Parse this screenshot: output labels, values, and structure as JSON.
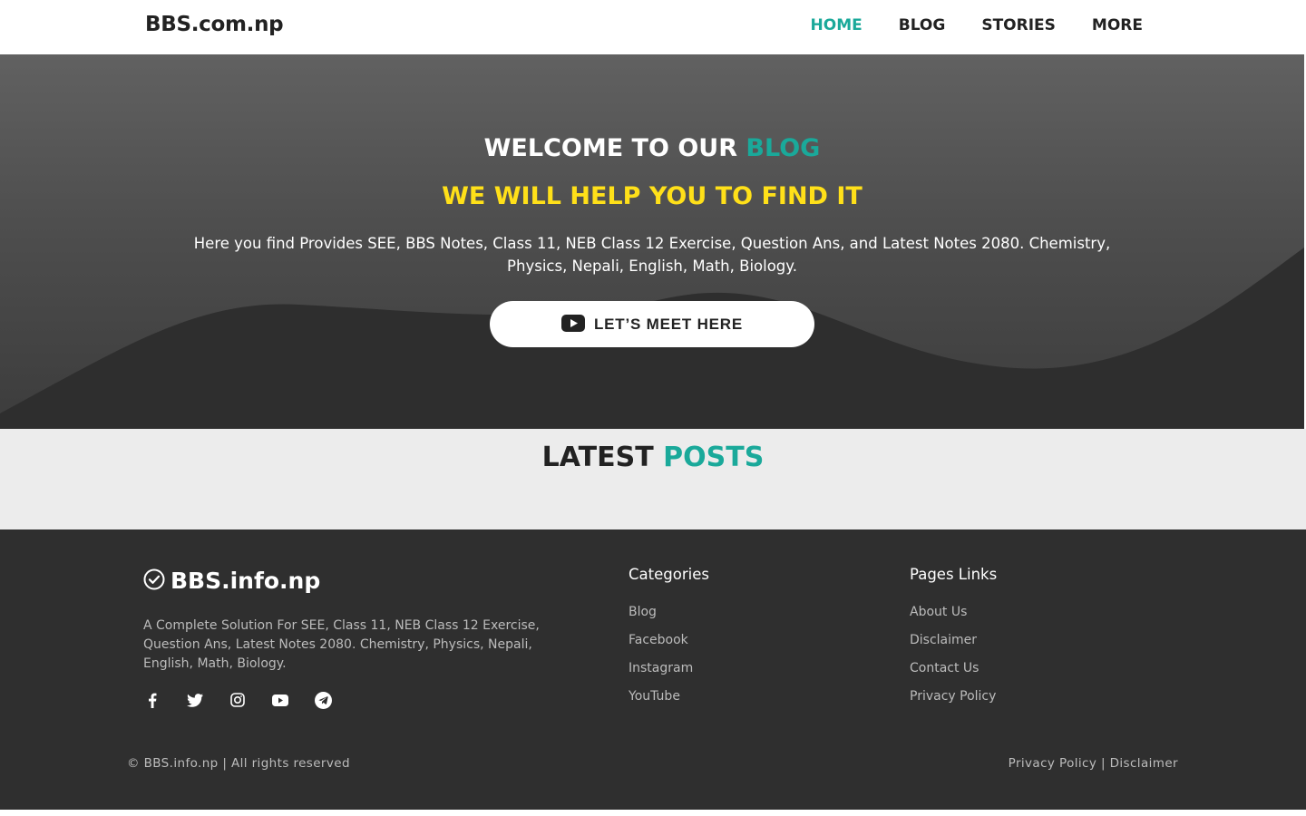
{
  "header": {
    "logo": "BBS.com.np",
    "nav": [
      {
        "label": "HOME",
        "active": true
      },
      {
        "label": "BLOG",
        "active": false
      },
      {
        "label": "STORIES",
        "active": false
      },
      {
        "label": "MORE",
        "active": false
      }
    ]
  },
  "hero": {
    "title_prefix": "WELCOME TO OUR",
    "title_accent": "BLOG",
    "subtitle": "WE WILL HELP YOU TO FIND IT",
    "description": "Here you find Provides SEE, BBS Notes, Class 11, NEB Class 12 Exercise, Question Ans, and Latest Notes 2080. Chemistry, Physics, Nepali, English, Math, Biology.",
    "button_label": "LET’S MEET HERE",
    "button_icon": "youtube-icon"
  },
  "latest": {
    "title_prefix": "LATEST",
    "title_accent": "POSTS"
  },
  "footer": {
    "brand": "BBS.info.np",
    "brand_icon": "check-circle-icon",
    "about": "A Complete Solution For SEE, Class 11, NEB Class 12 Exercise, Question Ans, Latest Notes 2080. Chemistry, Physics, Nepali, English, Math, Biology.",
    "social_icons": [
      "facebook-icon",
      "twitter-icon",
      "instagram-icon",
      "youtube-icon",
      "telegram-icon"
    ],
    "categories": {
      "heading": "Categories",
      "links": [
        "Blog",
        "Facebook",
        "Instagram",
        "YouTube"
      ]
    },
    "pages": {
      "heading": "Pages Links",
      "links": [
        "About Us",
        "Disclaimer",
        "Contact Us",
        "Privacy Policy"
      ]
    },
    "copyright": "© BBS.info.np | All rights reserved",
    "bottom_links": [
      "Privacy Policy",
      "Disclaimer"
    ],
    "bottom_separator": "|"
  },
  "colors": {
    "accent": "#1aa99a",
    "highlight": "#ffe019",
    "footer_bg": "#2f2f2f",
    "section_bg": "#ececec"
  }
}
